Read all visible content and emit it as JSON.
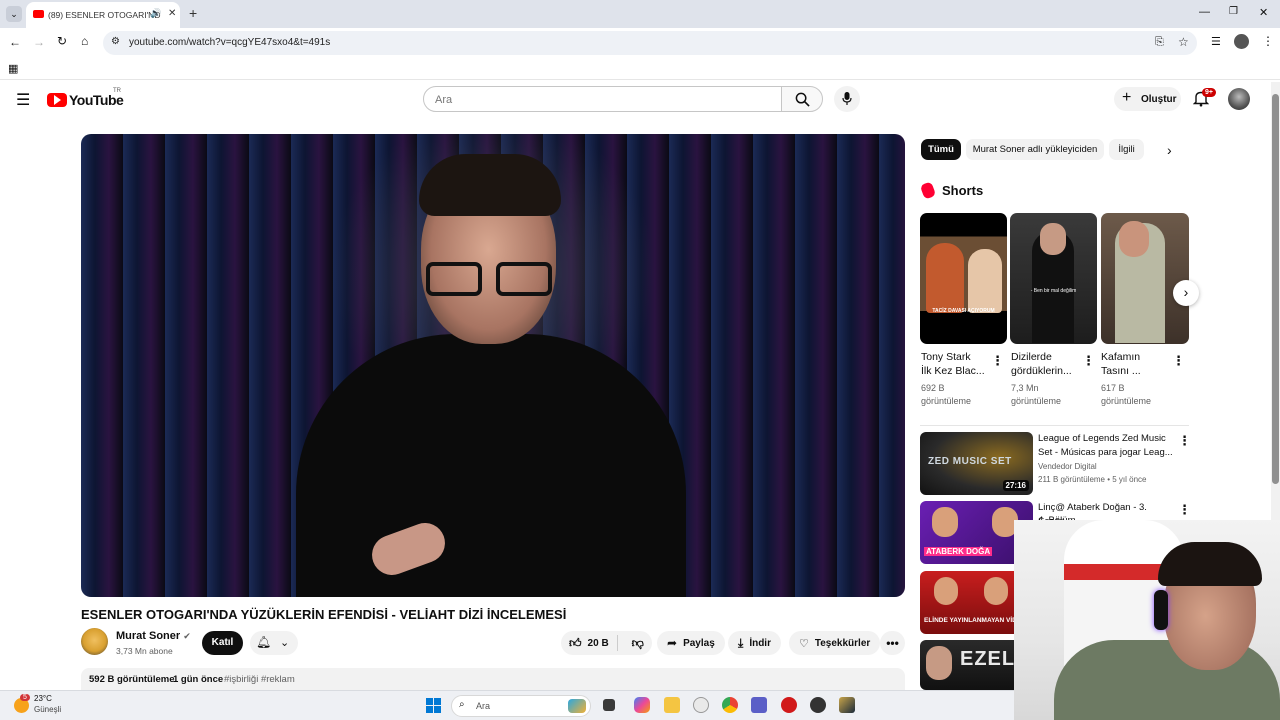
{
  "browser": {
    "tab_title": "(89) ESENLER OTOGARI'ND",
    "url": "youtube.com/watch?v=qcgYE47sxo4&t=491s"
  },
  "header": {
    "logo_text": "YouTube",
    "country": "TR",
    "search_placeholder": "Ara",
    "create_label": "Oluştur",
    "notif_badge": "9+"
  },
  "video": {
    "title": "ESENLER OTOGARI'NDA YÜZÜKLERİN EFENDİSİ - VELİAHT DİZİ İNCELEMESİ",
    "channel": "Murat Soner",
    "subscribers": "3,73 Mn abone",
    "join_label": "Katıl",
    "likes": "20 B",
    "share_label": "Paylaş",
    "download_label": "İndir",
    "thanks_label": "Teşekkürler",
    "views": "592 B görüntüleme",
    "age": "1 gün önce",
    "tags": "#işbirliği #reklam"
  },
  "chips": [
    "Tümü",
    "Murat Soner adlı yükleyiciden",
    "İlgili"
  ],
  "shorts": {
    "heading": "Shorts",
    "items": [
      {
        "title1": "Tony Stark",
        "title2": "İlk Kez Blac...",
        "views": "692 B",
        "unit": "görüntüleme",
        "overlay": "TACİZ DAVASI AÇIYORUM"
      },
      {
        "title1": "Dizilerde",
        "title2": "gördüklerin...",
        "views": "7,3 Mn",
        "unit": "görüntüleme",
        "overlay": "- Ben bir mal değilim"
      },
      {
        "title1": "Kafamın",
        "title2": "Tasını ...",
        "views": "617 B",
        "unit": "görüntüleme",
        "overlay": ""
      }
    ]
  },
  "related": [
    {
      "title1": "League of Legends Zed Music",
      "title2": "Set - Músicas para jogar Leag...",
      "channel": "Vendedor Digital",
      "meta": "211 B görüntüleme • 5 yıl önce",
      "duration": "27:16",
      "thumb_text": "ZED MUSIC SET"
    },
    {
      "title1": "Linç@ Ataberk Doğan - 3. Sezon",
      "title2": "4. Bölüm",
      "thumb_text": "ATABERK DOĞA"
    },
    {
      "thumb_text": "ELİNDE YAYINLANMAYAN VİDEO"
    },
    {
      "thumb_text": "EZEL"
    }
  ],
  "taskbar": {
    "temp": "23°C",
    "weather": "Güneşli",
    "weather_badge": "5",
    "search_label": "Ara"
  }
}
